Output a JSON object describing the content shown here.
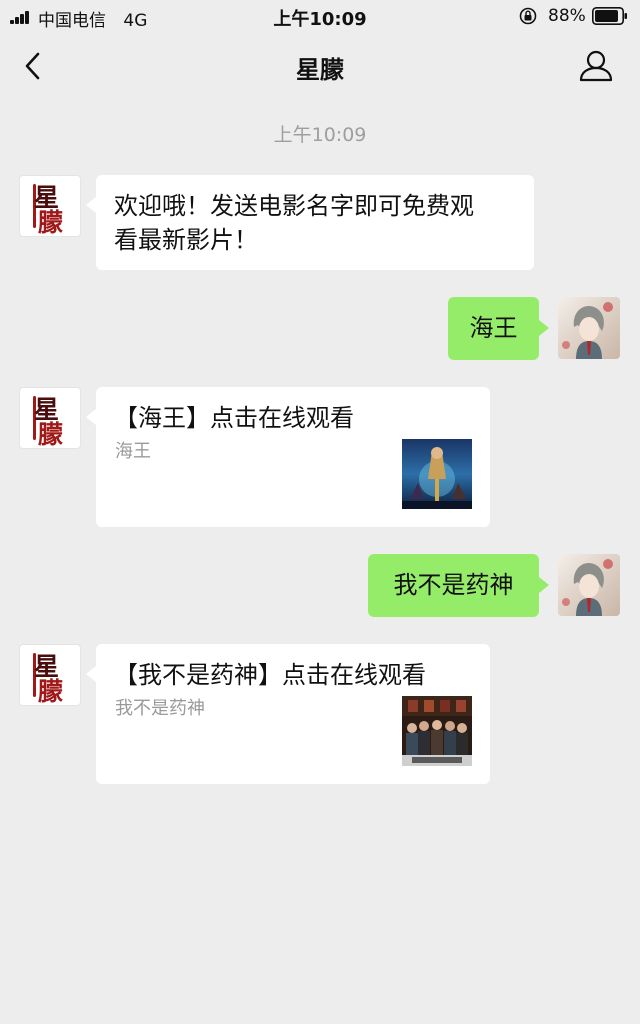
{
  "status_bar": {
    "carrier": "中国电信",
    "network": "4G",
    "time": "上午10:09",
    "battery": "88%"
  },
  "nav": {
    "title": "星朦",
    "back_icon": "chevron-left-icon",
    "profile_icon": "person-icon"
  },
  "chat": {
    "timestamp": "上午10:09",
    "bot_avatar_text": "星朦",
    "messages": [
      {
        "from": "bot",
        "text_line1": "欢迎哦！发送电影名字即可免费观",
        "text_line2": "看最新影片！"
      },
      {
        "from": "user",
        "text": "海王"
      },
      {
        "from": "bot",
        "card_title": "【海王】点击在线观看",
        "card_desc": "海王"
      },
      {
        "from": "user",
        "text": "我不是药神"
      },
      {
        "from": "bot",
        "card_title": "【我不是药神】点击在线观看",
        "card_desc": "我不是药神"
      }
    ]
  },
  "colors": {
    "background": "#ededed",
    "outgoing_bubble": "#95ec69",
    "incoming_bubble": "#ffffff",
    "muted_text": "#9e9e9e"
  }
}
